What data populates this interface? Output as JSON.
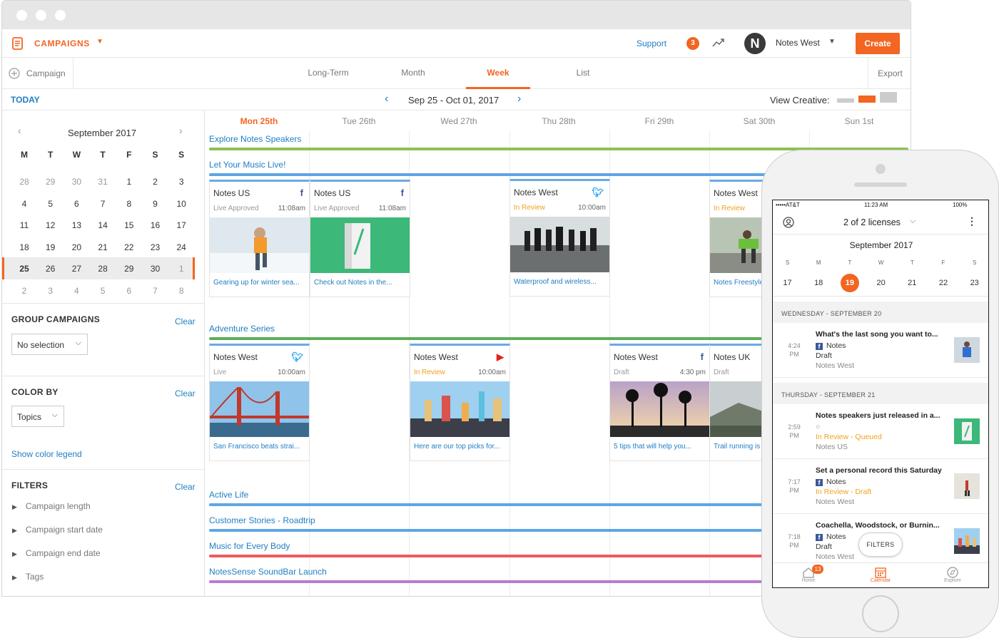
{
  "app": {
    "section": "CAMPAIGNS",
    "support": "Support",
    "notif_count": "3",
    "user": "Notes West",
    "avatar_letter": "N",
    "create": "Create"
  },
  "tabs": {
    "campaign": "Campaign",
    "items": [
      "Long-Term",
      "Month",
      "Week",
      "List"
    ],
    "active": "Week",
    "export": "Export"
  },
  "toolbar": {
    "today": "TODAY",
    "range": "Sep 25 - Oct 01, 2017",
    "view_creative": "View Creative:"
  },
  "mini_cal": {
    "month": "September 2017",
    "weekdays": [
      "M",
      "T",
      "W",
      "T",
      "F",
      "S",
      "S"
    ],
    "weeks": [
      [
        "28",
        "29",
        "30",
        "31",
        "1",
        "2",
        "3"
      ],
      [
        "4",
        "5",
        "6",
        "7",
        "8",
        "9",
        "10"
      ],
      [
        "11",
        "12",
        "13",
        "14",
        "15",
        "16",
        "17"
      ],
      [
        "18",
        "19",
        "20",
        "21",
        "22",
        "23",
        "24"
      ],
      [
        "25",
        "26",
        "27",
        "28",
        "29",
        "30",
        "1"
      ],
      [
        "2",
        "3",
        "4",
        "5",
        "6",
        "7",
        "8"
      ]
    ]
  },
  "sidebar": {
    "group_title": "GROUP CAMPAIGNS",
    "group_clear": "Clear",
    "group_value": "No selection",
    "color_title": "COLOR BY",
    "color_clear": "Clear",
    "color_value": "Topics",
    "color_legend": "Show color legend",
    "filters_title": "FILTERS",
    "filters_clear": "Clear",
    "filters": [
      "Campaign length",
      "Campaign start date",
      "Campaign end date",
      "Tags"
    ]
  },
  "days": [
    "Mon 25th",
    "Tue 26th",
    "Wed 27th",
    "Thu 28th",
    "Fri 29th",
    "Sat 30th",
    "Sun 1st"
  ],
  "campaigns": [
    "Explore Notes Speakers",
    "Let Your Music Live!",
    "Adventure Series",
    "Active Life",
    "Customer Stories - Roadtrip",
    "Music for Every Body",
    "NotesSense SoundBar Launch"
  ],
  "cards": [
    {
      "account": "Notes US",
      "status": "Live Approved",
      "time": "11:08am",
      "caption": "Gearing up for winter sea...",
      "icon": "f"
    },
    {
      "account": "Notes US",
      "status": "Live Approved",
      "time": "11:08am",
      "caption": "Check out Notes in the...",
      "icon": "f"
    },
    {
      "account": "Notes West",
      "status": "In Review",
      "time": "10:00am",
      "caption": "Waterproof and wireless...",
      "icon": "t"
    },
    {
      "account": "Notes West",
      "status": "In Review",
      "time": "",
      "caption": "Notes Freestyle",
      "icon": ""
    },
    {
      "account": "Notes West",
      "status": "Live",
      "time": "10:00am",
      "caption": "San Francisco beats strai...",
      "icon": "t"
    },
    {
      "account": "Notes West",
      "status": "In Review",
      "time": "10:00am",
      "caption": "Here are our top picks for...",
      "icon": "y"
    },
    {
      "account": "Notes West",
      "status": "Draft",
      "time": "4:30 pm",
      "caption": "5 tips that will help you...",
      "icon": "f"
    },
    {
      "account": "Notes UK",
      "status": "Draft",
      "time": "",
      "caption": "Trail running is",
      "icon": ""
    }
  ],
  "phone": {
    "carrier": "AT&T",
    "clock": "11:23 AM",
    "battery": "100%",
    "licenses": "2 of 2 licenses",
    "month": "September 2017",
    "weekdays": [
      "S",
      "M",
      "T",
      "W",
      "T",
      "F",
      "S"
    ],
    "dates": [
      "17",
      "18",
      "19",
      "20",
      "21",
      "22",
      "23"
    ],
    "selected": "19",
    "section1": "WEDNESDAY - SEPTEMBER 20",
    "section2": "THURSDAY - SEPTEMBER 21",
    "items": [
      {
        "time": "4:24",
        "ampm": "PM",
        "title": "What's the last song you want to...",
        "account": "Notes",
        "status": "Draft",
        "profile": "Notes West"
      },
      {
        "time": "2:59",
        "ampm": "PM",
        "title": "Notes speakers just released in a...",
        "account": "○",
        "status": "In Review - Queued",
        "profile": "Notes US"
      },
      {
        "time": "7:17",
        "ampm": "PM",
        "title": "Set a personal record this Saturday",
        "account": "Notes",
        "status": "In Review - Draft",
        "profile": "Notes West"
      },
      {
        "time": "7:18",
        "ampm": "PM",
        "title": "Coachella, Woodstock, or Burnin...",
        "account": "Notes",
        "status": "Draft",
        "profile": "Notes West"
      }
    ],
    "filters_btn": "FILTERS",
    "nav": [
      "Home",
      "Calendar",
      "Explore"
    ],
    "home_badge": "13"
  },
  "colors": {
    "accent": "#f26522",
    "link": "#1f7ec4",
    "green": "#8cc152",
    "blue": "#5ea5e4",
    "red": "#f05a5b",
    "purple": "#b97bd2",
    "amber": "#f0a21e"
  }
}
